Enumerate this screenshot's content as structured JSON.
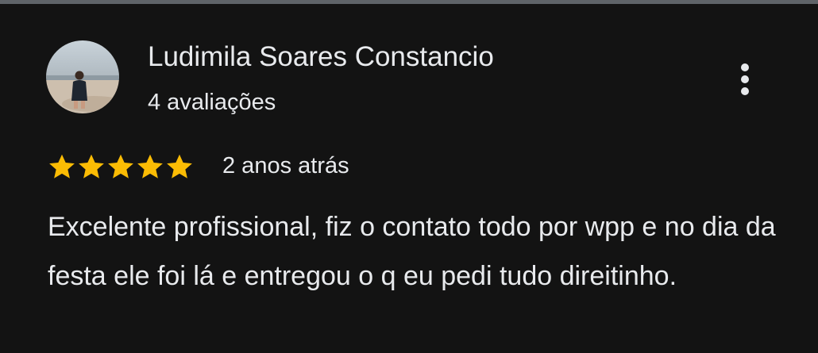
{
  "review": {
    "author_name": "Ludimila Soares Constancio",
    "review_count": "4 avaliações",
    "rating": 5,
    "rating_max": 5,
    "date": "2 anos atrás",
    "text": "Excelente profissional, fiz o contato todo por wpp e no dia da festa ele foi lá e entregou o q eu pedi tudo direitinho."
  },
  "colors": {
    "background": "#131313",
    "text": "#e8eaed",
    "star": "#fbbc04"
  },
  "icons": {
    "avatar": "avatar-photo",
    "star": "star-icon",
    "more": "more-vertical-icon"
  }
}
